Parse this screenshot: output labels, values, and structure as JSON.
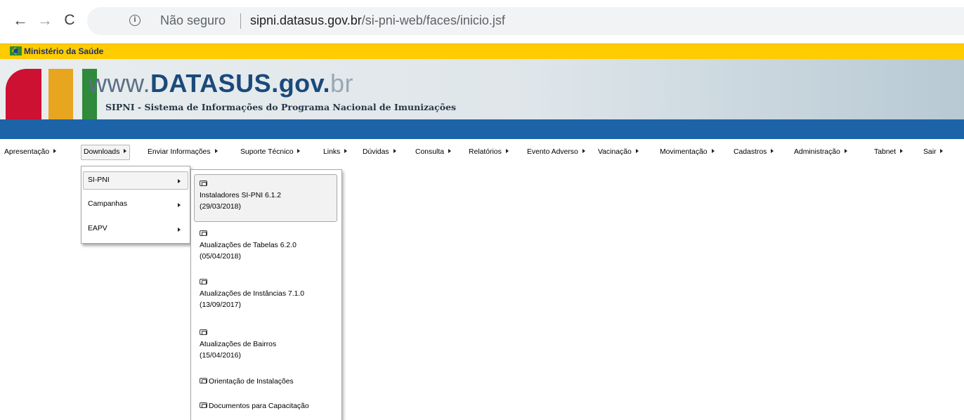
{
  "browser": {
    "not_secure": "Não seguro",
    "url_host": "sipni.datasus.gov.br",
    "url_path": "/si-pni-web/faces/inicio.jsf"
  },
  "ministry": {
    "label": "Ministério da Saúde"
  },
  "header": {
    "logo_w": "www.",
    "logo_name": "DATASUS",
    "logo_gov": ".gov.",
    "logo_br": "br",
    "subtitle": "SIPNI - Sistema de Informações do Programa Nacional de Imunizações"
  },
  "menu": {
    "items": [
      {
        "label": "Apresentação"
      },
      {
        "label": "Downloads"
      },
      {
        "label": "Enviar Informações"
      },
      {
        "label": "Suporte Técnico"
      },
      {
        "label": "Links"
      },
      {
        "label": "Dúvidas"
      },
      {
        "label": "Consulta"
      },
      {
        "label": "Relatórios"
      },
      {
        "label": "Evento Adverso"
      },
      {
        "label": "Vacinação"
      },
      {
        "label": "Movimentação"
      },
      {
        "label": "Cadastros"
      },
      {
        "label": "Administração"
      },
      {
        "label": "Tabnet"
      },
      {
        "label": "Sair"
      }
    ],
    "active": "Downloads"
  },
  "downloads_menu": {
    "items": [
      {
        "label": "SI-PNI"
      },
      {
        "label": "Campanhas"
      },
      {
        "label": "EAPV"
      }
    ],
    "active": "SI-PNI"
  },
  "sipni_submenu": {
    "items": [
      {
        "title": "Instaladores SI-PNI 6.1.2",
        "date": "(29/03/2018)"
      },
      {
        "title": "Atualizações de Tabelas 6.2.0",
        "date": "(05/04/2018)"
      },
      {
        "title": "Atualizações de Instâncias 7.1.0",
        "date": "(13/09/2017)"
      },
      {
        "title": "Atualizações de Bairros",
        "date": "(15/04/2016)"
      },
      {
        "title": "Orientação de Instalações"
      },
      {
        "title": "Documentos para Capacitação"
      }
    ],
    "icon": "file-icon"
  }
}
